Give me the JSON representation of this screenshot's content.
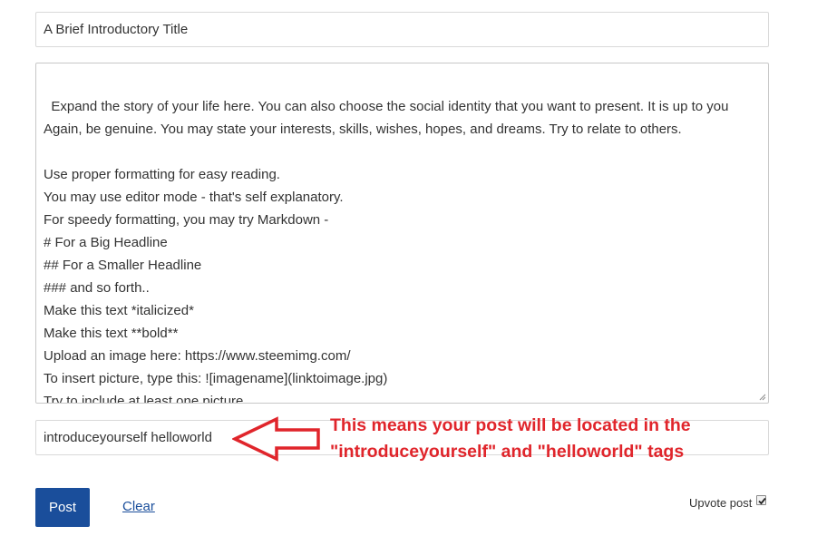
{
  "editor": {
    "title_value": "A Brief Introductory Title",
    "body_value": "Expand the story of your life here. You can also choose the social identity that you want to present. It is up to you\nAgain, be genuine. You may state your interests, skills, wishes, hopes, and dreams. Try to relate to others.\n\nUse proper formatting for easy reading.\nYou may use editor mode - that's self explanatory.\nFor speedy formatting, you may try Markdown -\n# For a Big Headline\n## For a Smaller Headline\n### and so forth..\nMake this text *italicized*\nMake this text **bold**\nUpload an image here: https://www.steemimg.com/\nTo insert picture, type this: ![imagename](linktoimage.jpg)\nTry to include at least one picture.",
    "tags_value": "introduceyourself helloworld"
  },
  "annotation": {
    "line1": "This means your post will be located in the",
    "line2": "\"introduceyourself\" and \"helloworld\" tags",
    "color": "#e0252b",
    "icon": "left-arrow-icon"
  },
  "actions": {
    "post_label": "Post",
    "clear_label": "Clear",
    "upvote_label": "Upvote post",
    "upvote_checked": true
  },
  "colors": {
    "primary": "#1a4e9b",
    "annotation_red": "#e0252b"
  }
}
